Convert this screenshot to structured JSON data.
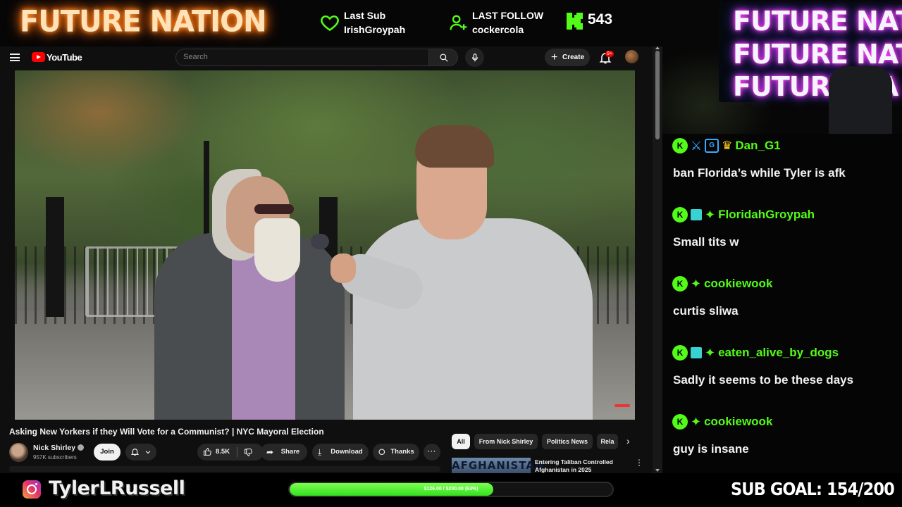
{
  "overlay": {
    "brand": "FUTURE NATION",
    "last_sub": {
      "label": "Last Sub",
      "name": "IrishGroypah"
    },
    "last_follow": {
      "label": "LAST FOLLOW",
      "name": "cockercola"
    },
    "kick_viewers": "543",
    "colors": {
      "accent": "#53fc18",
      "brand_glow": "#ff6a00",
      "neon_glow": "#ff3df0"
    },
    "icons": {
      "sub": "heart-outline-icon",
      "follow": "user-plus-icon",
      "kick": "kick-logo-icon"
    }
  },
  "youtube": {
    "logo_text": "YouTube",
    "search_placeholder": "Search",
    "create_label": "Create",
    "notification_badge": "9+",
    "video": {
      "title": "Asking New Yorkers if they Will Vote for a Communist? | NYC Mayoral Election",
      "channel": "Nick Shirley",
      "subscribers": "957K subscribers",
      "join_label": "Join",
      "likes": "8.5K",
      "share_label": "Share",
      "download_label": "Download",
      "thanks_label": "Thanks",
      "more_label": "···"
    },
    "chips": [
      "All",
      "From Nick Shirley",
      "Politics News",
      "Rela"
    ],
    "related": {
      "thumb_text": "AFGHANISTAN",
      "title": "Entering Taliban Controlled Afghanistan in 2025"
    }
  },
  "chat": {
    "cam_sign": [
      "FUTURE NATION",
      "FUTURE NATION",
      "FUTURE NA"
    ],
    "messages": [
      {
        "user": "Dan_G1",
        "text": "ban Florida’s while Tyler is afk",
        "badges": [
          "kick-icon",
          "sword-icon",
          "chip-icon",
          "crown-icon"
        ]
      },
      {
        "user": "FloridahGroypah",
        "text": "Small tits w",
        "badges": [
          "kick-icon",
          "gift-icon",
          "diamond-icon"
        ]
      },
      {
        "user": "cookiewook",
        "text": "curtis sliwa",
        "badges": [
          "kick-icon",
          "diamond-icon"
        ]
      },
      {
        "user": "eaten_alive_by_dogs",
        "text": "Sadly it seems to be these days",
        "badges": [
          "kick-icon",
          "gift-icon",
          "diamond-icon"
        ]
      },
      {
        "user": "cookiewook",
        "text": "guy is insane",
        "badges": [
          "kick-icon",
          "diamond-icon"
        ]
      }
    ]
  },
  "bottom": {
    "instagram_handle": "TylerLRussell",
    "goal_text": "$126.00 / $200.00 (63%)",
    "goal_progress": 0.63,
    "sub_goal": "SUB GOAL: 154/200"
  }
}
